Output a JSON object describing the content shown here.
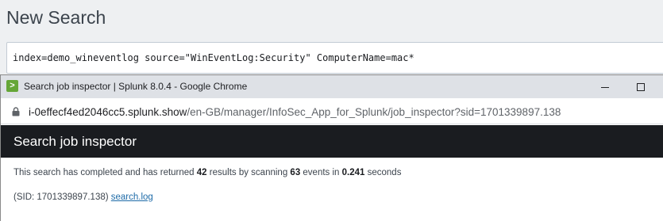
{
  "page": {
    "title": "New Search"
  },
  "search": {
    "query": "index=demo_wineventlog source=\"WinEventLog:Security\" ComputerName=mac*"
  },
  "popup": {
    "window_title": "Search job inspector | Splunk 8.0.4 - Google Chrome",
    "icon_glyph": ">",
    "url_host": "i-0effecf4ed2046cc5.splunk.show",
    "url_path": "/en-GB/manager/InfoSec_App_for_Splunk/job_inspector?sid=1701339897.138"
  },
  "inspector": {
    "title": "Search job inspector",
    "summary": {
      "prefix": "This search has completed and has returned ",
      "results": "42",
      "middle": " results by scanning ",
      "events": "63",
      "middle2": " events in ",
      "seconds": "0.241",
      "suffix": " seconds"
    },
    "sid_label": "(SID: 1701339897.138) ",
    "log_link": "search.log"
  },
  "colors": {
    "inspector_header_bg": "#1a1c20",
    "app_icon": "#65a637",
    "link": "#1e6ba8"
  }
}
